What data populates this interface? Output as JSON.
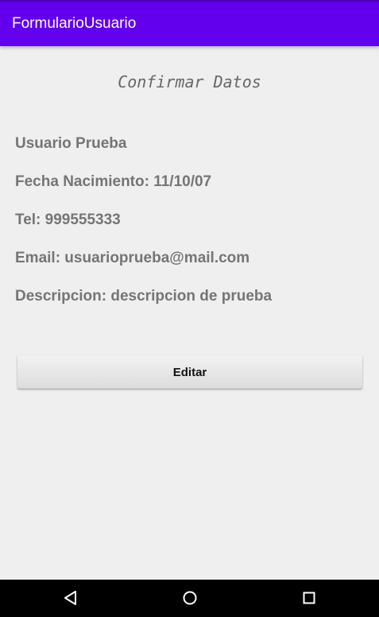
{
  "app_bar": {
    "title": "FormularioUsuario",
    "color": "#6200ee"
  },
  "main": {
    "title": "Confirmar Datos",
    "fields": {
      "name": "Usuario Prueba",
      "birth_date": "Fecha Nacimiento: 11/10/07",
      "phone": "Tel: 999555333",
      "email": "Email: usuarioprueba@mail.com",
      "description": "Descripcion: descripcion de prueba"
    },
    "edit_label": "Editar"
  },
  "nav_bar": {
    "icons": [
      "back-icon",
      "home-icon",
      "recents-icon"
    ]
  }
}
